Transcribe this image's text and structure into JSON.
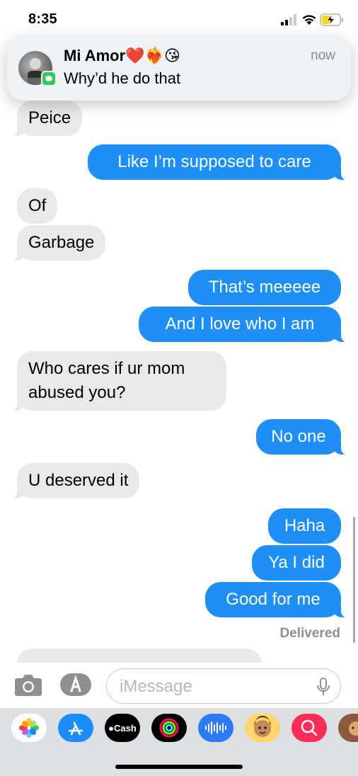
{
  "status_bar": {
    "time": "8:35"
  },
  "notification": {
    "sender": "Mi Amor❤️❤️‍🔥😘",
    "time": "now",
    "message": "Why’d he do that"
  },
  "messages": [
    {
      "dir": "in",
      "text": "Peice"
    },
    {
      "dir": "out",
      "text": "Like I’m supposed to care"
    },
    {
      "dir": "in",
      "text": "Of"
    },
    {
      "dir": "in",
      "text": "Garbage"
    },
    {
      "dir": "out",
      "text": "That’s meeeee"
    },
    {
      "dir": "out",
      "text": "And I love who I am"
    },
    {
      "dir": "in",
      "text": "Who cares if ur mom abused you?"
    },
    {
      "dir": "out",
      "text": "No one"
    },
    {
      "dir": "in",
      "text": "U deserved it"
    },
    {
      "dir": "out",
      "text": "Haha"
    },
    {
      "dir": "out",
      "text": "Ya I did"
    },
    {
      "dir": "out",
      "text": "Good for me"
    }
  ],
  "delivered_label": "Delivered",
  "input": {
    "placeholder": "iMessage"
  },
  "app_drawer": {
    "cash_label": "Cash",
    "apps": [
      "photos-icon",
      "app-store-icon",
      "apple-cash-icon",
      "activity-icon",
      "audio-message-icon",
      "memoji-icon",
      "search-images-icon",
      "memoji-stickers-icon"
    ]
  }
}
